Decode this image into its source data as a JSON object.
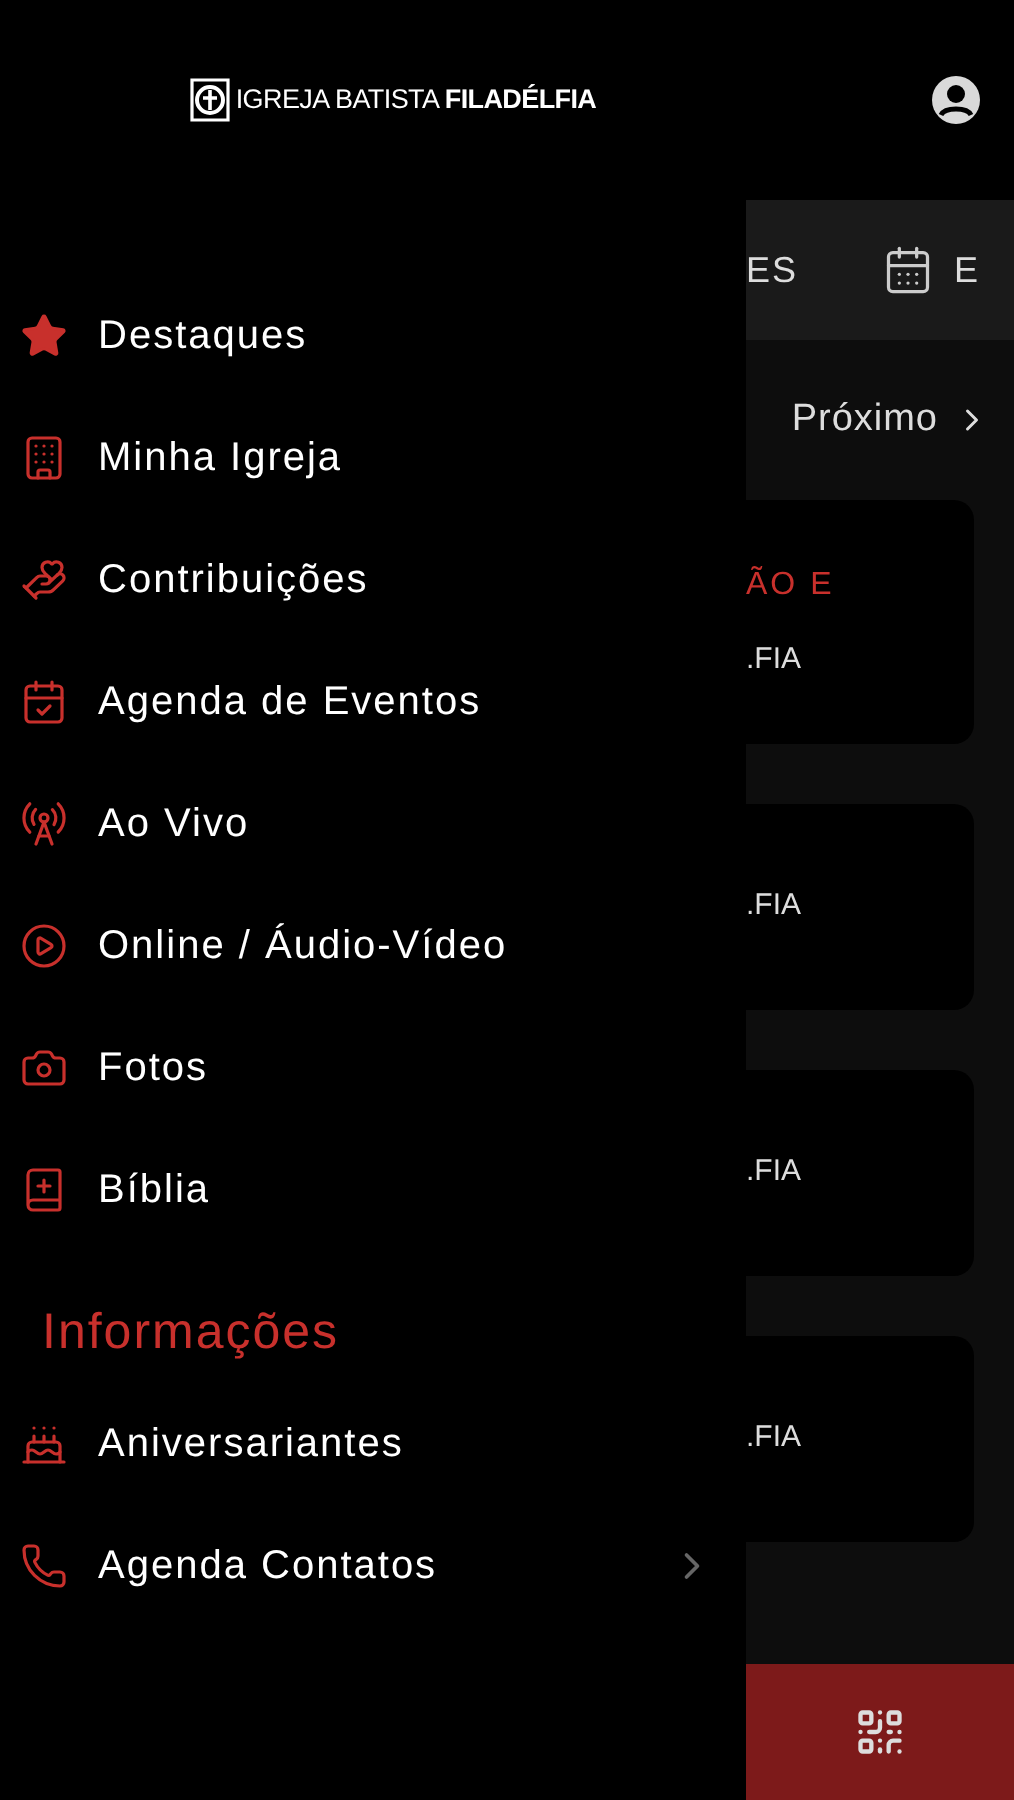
{
  "header": {
    "logo_text": "IGREJA BATISTA **FILADÉLFIA**"
  },
  "drawer": {
    "items": [
      {
        "label": "Destaques"
      },
      {
        "label": "Minha Igreja"
      },
      {
        "label": "Contribuições"
      },
      {
        "label": "Agenda de Eventos"
      },
      {
        "label": "Ao Vivo"
      },
      {
        "label": "Online / Áudio-Vídeo"
      },
      {
        "label": "Fotos"
      },
      {
        "label": "Bíblia"
      }
    ],
    "section_title": "Informações",
    "info_items": [
      {
        "label": "Aniversariantes",
        "has_submenu": false
      },
      {
        "label": "Agenda Contatos",
        "has_submenu": true
      }
    ]
  },
  "background": {
    "tabs": [
      {
        "label": "ES"
      },
      {
        "label": "E"
      }
    ],
    "next_button": "Próximo",
    "cards": [
      {
        "title": "ÃO E",
        "subtitle": ".FIA"
      },
      {
        "subtitle": ".FIA"
      },
      {
        "subtitle": ".FIA"
      },
      {
        "subtitle": ".FIA"
      }
    ]
  }
}
